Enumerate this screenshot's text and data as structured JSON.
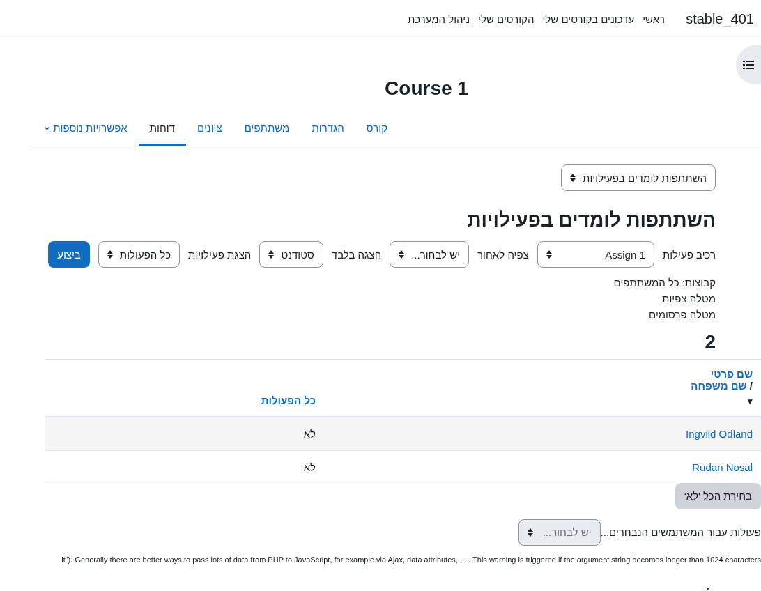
{
  "navbar": {
    "site_name": "stable_401",
    "links": [
      {
        "label": "ראשי",
        "selected": false
      },
      {
        "label": "עדכונים בקורסים שלי",
        "selected": false
      },
      {
        "label": "הקורסים שלי",
        "selected": false
      },
      {
        "label": "ניהול המערכת",
        "selected": false
      }
    ]
  },
  "course_title": "Course 1",
  "tabs": [
    {
      "label": "קורס",
      "selected": false
    },
    {
      "label": "הגדרות",
      "selected": false
    },
    {
      "label": "משתתפים",
      "selected": false
    },
    {
      "label": "ציונים",
      "selected": false
    },
    {
      "label": "דוחות",
      "selected": true
    },
    {
      "label": "אפשרויות נוספות",
      "selected": false,
      "kind": "dropdown"
    }
  ],
  "report_selector": "השתתפות לומדים בפעילויות",
  "heading": "השתתפות לומדים בפעילויות",
  "filters": [
    {
      "label": "רכיב פעילות",
      "value": "Assign 1"
    },
    {
      "label": "צפיה לאחור",
      "value": "יש לבחור..."
    },
    {
      "label": "הצגה בלבד",
      "value": "סטודנט"
    },
    {
      "label": "הצגת פעילויות",
      "value": "כל הפעולות"
    }
  ],
  "go_button": "ביצוע",
  "info_lines": [
    "קבוצות: כל המשתתפים",
    "מטלה צפיות",
    "מטלה פרסומים"
  ],
  "count": "2",
  "table": {
    "columns": [
      {
        "first": "שם פרטי",
        "separator": "/",
        "second": "שם משפחה",
        "sort": "▾"
      },
      {
        "label": "כל הפעולות"
      }
    ],
    "rows": [
      {
        "name": "Ingvild Odland",
        "value": "לא"
      },
      {
        "name": "Rudan Nosal",
        "value": "לא"
      }
    ]
  },
  "select_all_button": "בחירת הכל 'לא'",
  "bulk_action": {
    "label": "פעולות עבור המשתמשים הנבחרים...",
    "placeholder": "יש לבחור...",
    "disabled": true
  },
  "warning": "it\"). Generally there are better ways to pass lots of data from PHP to JavaScript, for example via Ajax, data attributes, ... . This warning is triggered if the argument string becomes longer than 1024 characters"
}
